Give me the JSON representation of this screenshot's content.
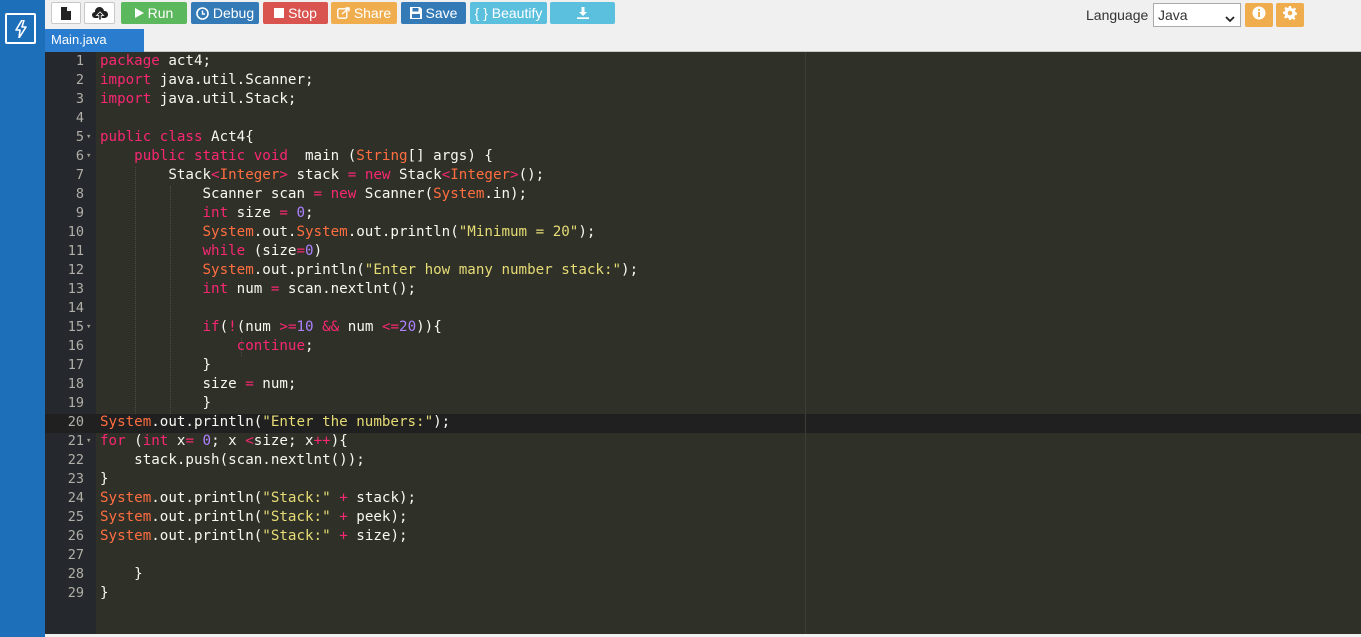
{
  "app": {
    "tab": "Main.java",
    "language_label": "Language",
    "language_value": "Java"
  },
  "toolbar": {
    "run_label": "Run",
    "debug_label": "Debug",
    "stop_label": "Stop",
    "share_label": "Share",
    "save_label": "Save",
    "beautify_label": "{ } Beautify"
  },
  "icons": {
    "logo": "lightning-bolt-icon",
    "new_file": "file-icon",
    "upload": "cloud-upload-icon",
    "run": "play-icon",
    "debug": "clock-icon",
    "stop": "stop-icon",
    "share": "share-icon",
    "save": "floppy-disk-icon",
    "download": "download-icon",
    "info": "info-icon",
    "settings": "gear-icon"
  },
  "colors": {
    "rail": "#1e6fba",
    "run": "#5cb85c",
    "debug": "#337ab7",
    "stop": "#d9534f",
    "share": "#f0ad4e",
    "beautify": "#5bc0de",
    "editor_bg": "#2f3129",
    "keyword": "#f92672",
    "type": "#ff6e40",
    "string": "#e6db74",
    "number": "#ae81ff"
  },
  "editor": {
    "active_line": 20,
    "lines": [
      {
        "n": "1",
        "fold": "",
        "tokens": [
          {
            "t": "package",
            "c": "kw"
          },
          {
            "t": " act4;",
            "c": "plain"
          }
        ]
      },
      {
        "n": "2",
        "fold": "",
        "tokens": [
          {
            "t": "import",
            "c": "kw"
          },
          {
            "t": " java.util.Scanner;",
            "c": "plain"
          }
        ]
      },
      {
        "n": "3",
        "fold": "",
        "tokens": [
          {
            "t": "import",
            "c": "kw"
          },
          {
            "t": " java.util.Stack;",
            "c": "plain"
          }
        ]
      },
      {
        "n": "4",
        "fold": "",
        "tokens": []
      },
      {
        "n": "5",
        "fold": "▾",
        "tokens": [
          {
            "t": "public",
            "c": "kw"
          },
          {
            "t": " ",
            "c": "plain"
          },
          {
            "t": "class",
            "c": "kw"
          },
          {
            "t": " Act4{",
            "c": "plain"
          }
        ]
      },
      {
        "n": "6",
        "fold": "▾",
        "tokens": [
          {
            "t": "    ",
            "c": "plain"
          },
          {
            "t": "public",
            "c": "kw"
          },
          {
            "t": " ",
            "c": "plain"
          },
          {
            "t": "static",
            "c": "kw"
          },
          {
            "t": " ",
            "c": "plain"
          },
          {
            "t": "void",
            "c": "kw"
          },
          {
            "t": "  main (",
            "c": "plain"
          },
          {
            "t": "String",
            "c": "type"
          },
          {
            "t": "[] args) {",
            "c": "plain"
          }
        ]
      },
      {
        "n": "7",
        "fold": "",
        "tokens": [
          {
            "t": "        Stack",
            "c": "plain"
          },
          {
            "t": "<",
            "c": "op"
          },
          {
            "t": "Integer",
            "c": "type"
          },
          {
            "t": ">",
            "c": "op"
          },
          {
            "t": " stack ",
            "c": "plain"
          },
          {
            "t": "=",
            "c": "op"
          },
          {
            "t": " ",
            "c": "plain"
          },
          {
            "t": "new",
            "c": "kw"
          },
          {
            "t": " Stack",
            "c": "plain"
          },
          {
            "t": "<",
            "c": "op"
          },
          {
            "t": "Integer",
            "c": "type"
          },
          {
            "t": ">",
            "c": "op"
          },
          {
            "t": "();",
            "c": "plain"
          }
        ]
      },
      {
        "n": "8",
        "fold": "",
        "tokens": [
          {
            "t": "            Scanner scan ",
            "c": "plain"
          },
          {
            "t": "=",
            "c": "op"
          },
          {
            "t": " ",
            "c": "plain"
          },
          {
            "t": "new",
            "c": "kw"
          },
          {
            "t": " Scanner(",
            "c": "plain"
          },
          {
            "t": "System",
            "c": "type"
          },
          {
            "t": ".in);",
            "c": "plain"
          }
        ]
      },
      {
        "n": "9",
        "fold": "",
        "tokens": [
          {
            "t": "            ",
            "c": "plain"
          },
          {
            "t": "int",
            "c": "kw"
          },
          {
            "t": " size ",
            "c": "plain"
          },
          {
            "t": "=",
            "c": "op"
          },
          {
            "t": " ",
            "c": "plain"
          },
          {
            "t": "0",
            "c": "num"
          },
          {
            "t": ";",
            "c": "plain"
          }
        ]
      },
      {
        "n": "10",
        "fold": "",
        "tokens": [
          {
            "t": "            ",
            "c": "plain"
          },
          {
            "t": "System",
            "c": "type"
          },
          {
            "t": ".out.",
            "c": "plain"
          },
          {
            "t": "System",
            "c": "type"
          },
          {
            "t": ".out.println(",
            "c": "plain"
          },
          {
            "t": "\"Minimum = 20\"",
            "c": "str"
          },
          {
            "t": ");",
            "c": "plain"
          }
        ]
      },
      {
        "n": "11",
        "fold": "",
        "tokens": [
          {
            "t": "            ",
            "c": "plain"
          },
          {
            "t": "while",
            "c": "kw"
          },
          {
            "t": " (size",
            "c": "plain"
          },
          {
            "t": "=",
            "c": "op"
          },
          {
            "t": "0",
            "c": "num"
          },
          {
            "t": ")",
            "c": "plain"
          }
        ]
      },
      {
        "n": "12",
        "fold": "",
        "tokens": [
          {
            "t": "            ",
            "c": "plain"
          },
          {
            "t": "System",
            "c": "type"
          },
          {
            "t": ".out.println(",
            "c": "plain"
          },
          {
            "t": "\"Enter how many number stack:\"",
            "c": "str"
          },
          {
            "t": ");",
            "c": "plain"
          }
        ]
      },
      {
        "n": "13",
        "fold": "",
        "tokens": [
          {
            "t": "            ",
            "c": "plain"
          },
          {
            "t": "int",
            "c": "kw"
          },
          {
            "t": " num ",
            "c": "plain"
          },
          {
            "t": "=",
            "c": "op"
          },
          {
            "t": " scan.nextlnt();",
            "c": "plain"
          }
        ]
      },
      {
        "n": "14",
        "fold": "",
        "tokens": []
      },
      {
        "n": "15",
        "fold": "▾",
        "tokens": [
          {
            "t": "            ",
            "c": "plain"
          },
          {
            "t": "if",
            "c": "kw"
          },
          {
            "t": "(",
            "c": "plain"
          },
          {
            "t": "!",
            "c": "op"
          },
          {
            "t": "(num ",
            "c": "plain"
          },
          {
            "t": ">=",
            "c": "op"
          },
          {
            "t": "10",
            "c": "num"
          },
          {
            "t": " ",
            "c": "plain"
          },
          {
            "t": "&&",
            "c": "op"
          },
          {
            "t": " num ",
            "c": "plain"
          },
          {
            "t": "<=",
            "c": "op"
          },
          {
            "t": "20",
            "c": "num"
          },
          {
            "t": ")){",
            "c": "plain"
          }
        ]
      },
      {
        "n": "16",
        "fold": "",
        "tokens": [
          {
            "t": "                ",
            "c": "plain"
          },
          {
            "t": "continue",
            "c": "kw"
          },
          {
            "t": ";",
            "c": "plain"
          }
        ]
      },
      {
        "n": "17",
        "fold": "",
        "tokens": [
          {
            "t": "            }",
            "c": "plain"
          }
        ]
      },
      {
        "n": "18",
        "fold": "",
        "tokens": [
          {
            "t": "            size ",
            "c": "plain"
          },
          {
            "t": "=",
            "c": "op"
          },
          {
            "t": " num;",
            "c": "plain"
          }
        ]
      },
      {
        "n": "19",
        "fold": "",
        "tokens": [
          {
            "t": "            }",
            "c": "plain"
          }
        ]
      },
      {
        "n": "20",
        "fold": "",
        "tokens": [
          {
            "t": "System",
            "c": "type"
          },
          {
            "t": ".out.println(",
            "c": "plain"
          },
          {
            "t": "\"Enter the numbers:\"",
            "c": "str"
          },
          {
            "t": ");",
            "c": "plain"
          }
        ]
      },
      {
        "n": "21",
        "fold": "▾",
        "tokens": [
          {
            "t": "for",
            "c": "kw"
          },
          {
            "t": " (",
            "c": "plain"
          },
          {
            "t": "int",
            "c": "kw"
          },
          {
            "t": " x",
            "c": "plain"
          },
          {
            "t": "=",
            "c": "op"
          },
          {
            "t": " ",
            "c": "plain"
          },
          {
            "t": "0",
            "c": "num"
          },
          {
            "t": "; x ",
            "c": "plain"
          },
          {
            "t": "<",
            "c": "op"
          },
          {
            "t": "size; x",
            "c": "plain"
          },
          {
            "t": "++",
            "c": "op"
          },
          {
            "t": "){",
            "c": "plain"
          }
        ]
      },
      {
        "n": "22",
        "fold": "",
        "tokens": [
          {
            "t": "    stack.push(scan.nextlnt());",
            "c": "plain"
          }
        ]
      },
      {
        "n": "23",
        "fold": "",
        "tokens": [
          {
            "t": "}",
            "c": "plain"
          }
        ]
      },
      {
        "n": "24",
        "fold": "",
        "tokens": [
          {
            "t": "System",
            "c": "type"
          },
          {
            "t": ".out.println(",
            "c": "plain"
          },
          {
            "t": "\"Stack:\"",
            "c": "str"
          },
          {
            "t": " ",
            "c": "plain"
          },
          {
            "t": "+",
            "c": "op"
          },
          {
            "t": " stack);",
            "c": "plain"
          }
        ]
      },
      {
        "n": "25",
        "fold": "",
        "tokens": [
          {
            "t": "System",
            "c": "type"
          },
          {
            "t": ".out.println(",
            "c": "plain"
          },
          {
            "t": "\"Stack:\"",
            "c": "str"
          },
          {
            "t": " ",
            "c": "plain"
          },
          {
            "t": "+",
            "c": "op"
          },
          {
            "t": " peek);",
            "c": "plain"
          }
        ]
      },
      {
        "n": "26",
        "fold": "",
        "tokens": [
          {
            "t": "System",
            "c": "type"
          },
          {
            "t": ".out.println(",
            "c": "plain"
          },
          {
            "t": "\"Stack:\"",
            "c": "str"
          },
          {
            "t": " ",
            "c": "plain"
          },
          {
            "t": "+",
            "c": "op"
          },
          {
            "t": " size);",
            "c": "plain"
          }
        ]
      },
      {
        "n": "27",
        "fold": "",
        "tokens": []
      },
      {
        "n": "28",
        "fold": "",
        "tokens": [
          {
            "t": "    }",
            "c": "plain"
          }
        ]
      },
      {
        "n": "29",
        "fold": "",
        "tokens": [
          {
            "t": "}",
            "c": "plain"
          }
        ]
      }
    ]
  }
}
